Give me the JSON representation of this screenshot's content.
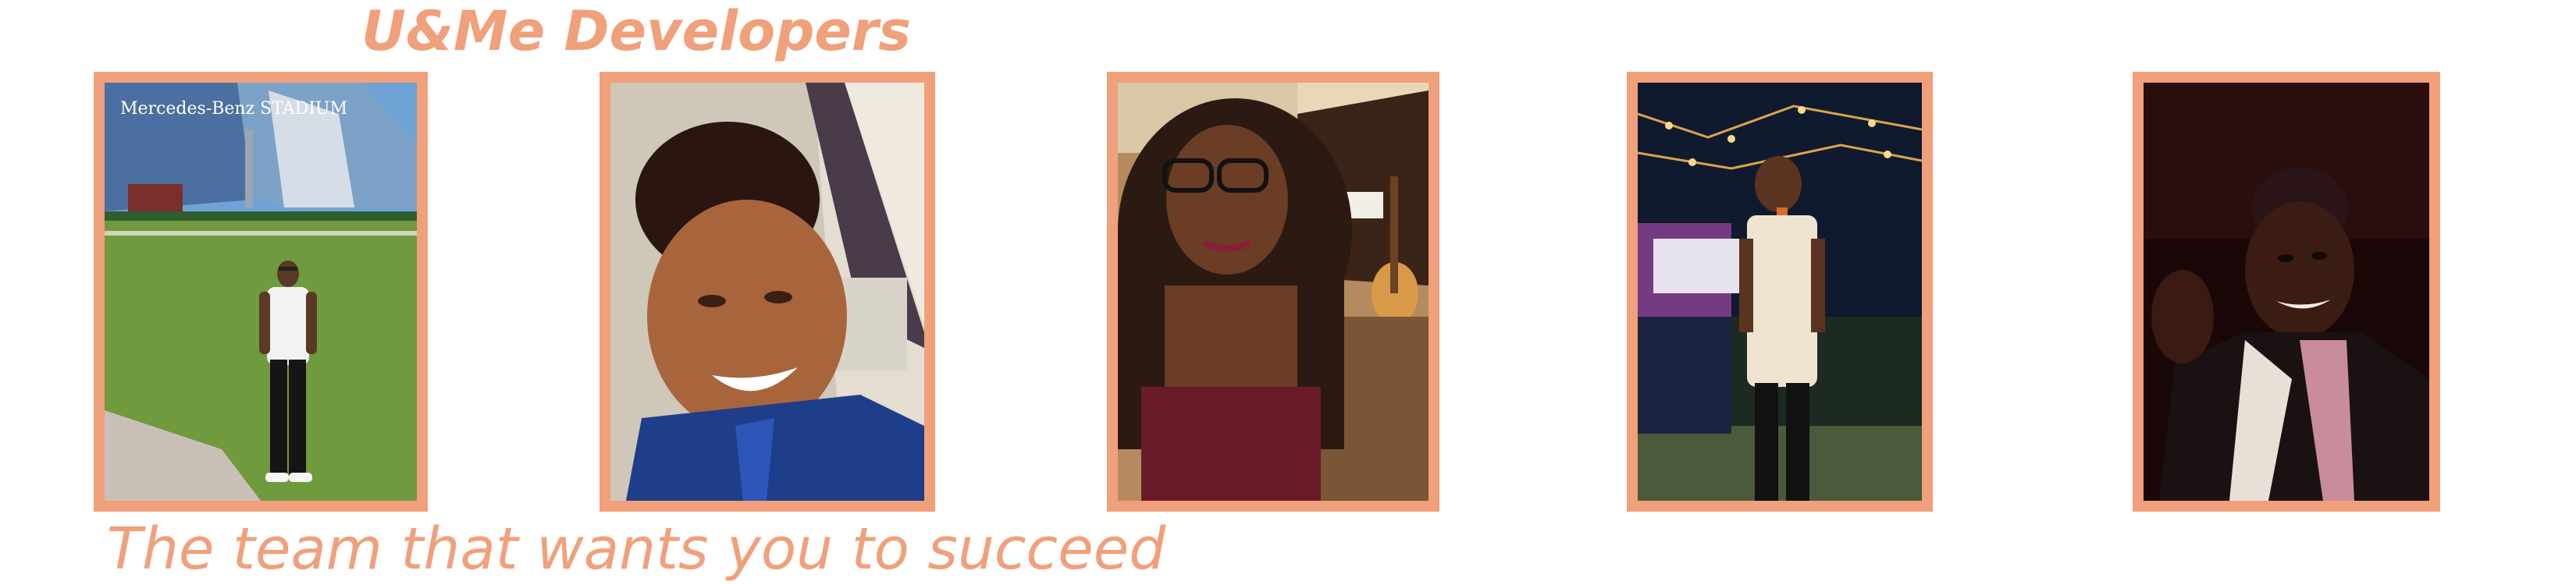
{
  "header": {
    "title": "U&Me Developers"
  },
  "footer": {
    "tagline": "The team that wants you to succeed"
  },
  "team_photos": [
    {
      "sign_text": "Mercedes-Benz STADIUM"
    },
    {},
    {},
    {},
    {}
  ],
  "colors": {
    "accent": "#f0a07a",
    "background": "#ffffff"
  }
}
